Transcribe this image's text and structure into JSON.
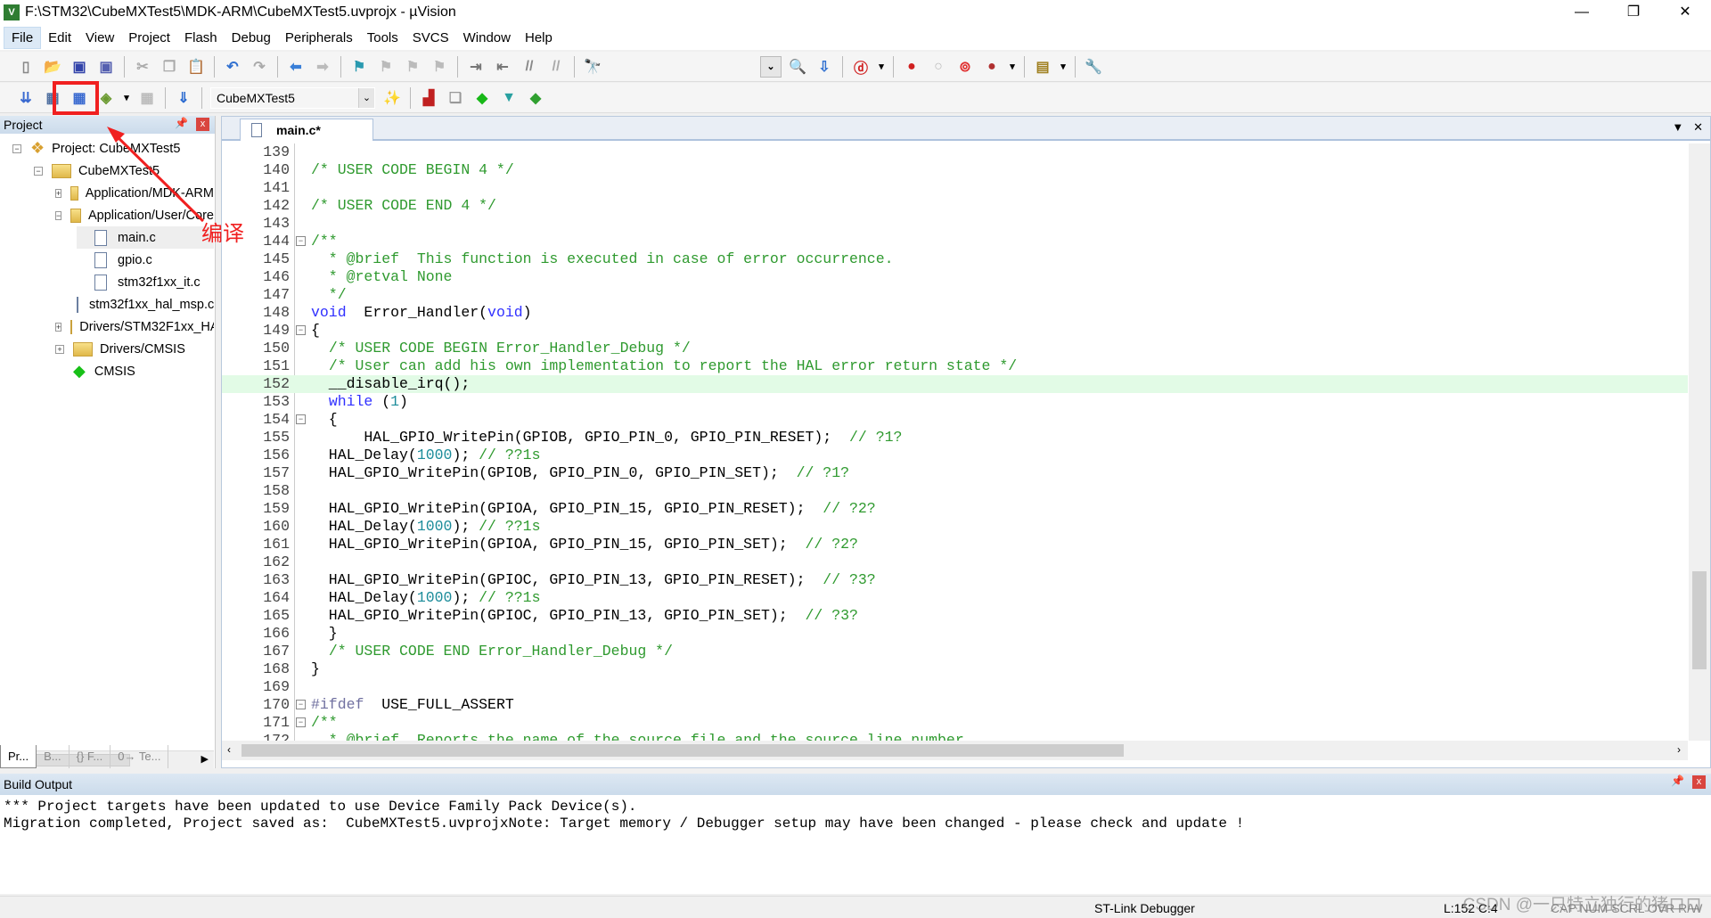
{
  "window": {
    "title": "F:\\STM32\\CubeMXTest5\\MDK-ARM\\CubeMXTest5.uvprojx - µVision",
    "icon_text": "V5"
  },
  "menu": [
    "File",
    "Edit",
    "View",
    "Project",
    "Flash",
    "Debug",
    "Peripherals",
    "Tools",
    "SVCS",
    "Window",
    "Help"
  ],
  "toolbar1": [
    {
      "icon": "new-file-icon",
      "g": "▯",
      "col": "#888"
    },
    {
      "icon": "open-icon",
      "g": "📂",
      "col": "#d8a030"
    },
    {
      "icon": "save-icon",
      "g": "▣",
      "col": "#3344aa"
    },
    {
      "icon": "save-all-icon",
      "g": "▣",
      "col": "#5560b0"
    },
    "|",
    {
      "icon": "cut-icon",
      "g": "✂",
      "col": "#aaa"
    },
    {
      "icon": "copy-icon",
      "g": "❐",
      "col": "#aaa"
    },
    {
      "icon": "paste-icon",
      "g": "📋",
      "col": "#c09030"
    },
    "|",
    {
      "icon": "undo-icon",
      "g": "↶",
      "col": "#3070d0"
    },
    {
      "icon": "redo-icon",
      "g": "↷",
      "col": "#aaa"
    },
    "|",
    {
      "icon": "back-icon",
      "g": "⬅",
      "col": "#3a80d8"
    },
    {
      "icon": "forward-icon",
      "g": "➡",
      "col": "#bbb"
    },
    "|",
    {
      "icon": "bookmark-icon",
      "g": "⚑",
      "col": "#2a9ab0"
    },
    {
      "icon": "prev-bookmark-icon",
      "g": "⚑",
      "col": "#bbb"
    },
    {
      "icon": "next-bookmark-icon",
      "g": "⚑",
      "col": "#bbb"
    },
    {
      "icon": "clear-bookmarks-icon",
      "g": "⚑",
      "col": "#bbb"
    },
    "|",
    {
      "icon": "indent-icon",
      "g": "⇥",
      "col": "#777"
    },
    {
      "icon": "unindent-icon",
      "g": "⇤",
      "col": "#777"
    },
    {
      "icon": "comment-icon",
      "g": "//",
      "col": "#888"
    },
    {
      "icon": "uncomment-icon",
      "g": "//",
      "col": "#aaa"
    },
    "|",
    {
      "icon": "find-in-files-icon",
      "g": "🔭",
      "col": "#c09030"
    }
  ],
  "toolbar1b": [
    {
      "icon": "find-icon",
      "g": "🔍",
      "col": "#555"
    },
    {
      "icon": "incremental-find-icon",
      "g": "⇩",
      "col": "#3070d0"
    },
    "|",
    {
      "icon": "debug-session-icon",
      "g": "ⓓ",
      "col": "#d02020"
    },
    {
      "icon": "dropdown-arrow-icon",
      "g": "▾",
      "col": "#000"
    },
    "|",
    {
      "icon": "breakpoint-icon",
      "g": "●",
      "col": "#d02020"
    },
    {
      "icon": "disable-breakpoint-icon",
      "g": "○",
      "col": "#bbb"
    },
    {
      "icon": "disable-all-breakpoints-icon",
      "g": "⊚",
      "col": "#e03030"
    },
    {
      "icon": "kill-breakpoints-icon",
      "g": "●",
      "col": "#b03030"
    },
    {
      "icon": "dropdown-arrow-icon",
      "g": "▾",
      "col": "#000"
    },
    "|",
    {
      "icon": "window-layout-icon",
      "g": "▤",
      "col": "#a08020"
    },
    {
      "icon": "dropdown-arrow-icon",
      "g": "▾",
      "col": "#000"
    },
    "|",
    {
      "icon": "configure-icon",
      "g": "🔧",
      "col": "#557"
    }
  ],
  "toolbar2": [
    {
      "icon": "translate-icon",
      "g": "⇊",
      "col": "#3a6ad0"
    },
    {
      "icon": "build-icon",
      "g": "▦",
      "col": "#5070a0"
    },
    {
      "icon": "rebuild-icon",
      "g": "▦",
      "col": "#3a6ad0"
    },
    {
      "icon": "batch-build-icon",
      "g": "◈",
      "col": "#6a9a30"
    },
    {
      "icon": "dropdown-arrow-icon",
      "g": "▾",
      "col": "#000"
    },
    {
      "icon": "stop-build-icon",
      "g": "▦",
      "col": "#bbb"
    },
    "|",
    {
      "icon": "download-load-icon",
      "g": "⇓",
      "col": "#2a6ad0"
    },
    "|"
  ],
  "toolbar2b": [
    {
      "icon": "options-for-target-icon",
      "g": "✨",
      "col": "#3060b0"
    },
    "|",
    {
      "icon": "manage-project-items-icon",
      "g": "▟",
      "col": "#c02020"
    },
    {
      "icon": "select-packs-icon",
      "g": "❏",
      "col": "#999"
    },
    {
      "icon": "manage-rte-icon",
      "g": "◆",
      "col": "#18b818"
    },
    {
      "icon": "pack-installer-icon",
      "g": "▼",
      "col": "#28a0a0"
    },
    {
      "icon": "pack-icon",
      "g": "◆",
      "col": "#30a030"
    }
  ],
  "target_select": "CubeMXTest5",
  "project_panel": {
    "title": "Project",
    "tree": [
      {
        "label": "Project: CubeMXTest5",
        "level": 0,
        "toggle": "−",
        "type": "project"
      },
      {
        "label": "CubeMXTest5",
        "level": 1,
        "toggle": "−",
        "type": "target"
      },
      {
        "label": "Application/MDK-ARM",
        "level": 2,
        "toggle": "+",
        "type": "folder"
      },
      {
        "label": "Application/User/Core",
        "level": 2,
        "toggle": "−",
        "type": "folder"
      },
      {
        "label": "main.c",
        "level": 3,
        "toggle": "",
        "type": "file",
        "selected": true
      },
      {
        "label": "gpio.c",
        "level": 3,
        "toggle": "",
        "type": "file"
      },
      {
        "label": "stm32f1xx_it.c",
        "level": 3,
        "toggle": "",
        "type": "file"
      },
      {
        "label": "stm32f1xx_hal_msp.c",
        "level": 3,
        "toggle": "",
        "type": "file"
      },
      {
        "label": "Drivers/STM32F1xx_HAL_Driver",
        "level": 2,
        "toggle": "+",
        "type": "folder"
      },
      {
        "label": "Drivers/CMSIS",
        "level": 2,
        "toggle": "+",
        "type": "folder"
      },
      {
        "label": "CMSIS",
        "level": 2,
        "toggle": "",
        "type": "rte"
      }
    ]
  },
  "panel_tabs": [
    "Pr...",
    "B...",
    "{} F...",
    "0→ Te..."
  ],
  "editor": {
    "tab": "main.c*",
    "highlight_line": 152,
    "lines": [
      {
        "n": 139,
        "s": []
      },
      {
        "n": 140,
        "s": [
          [
            "c",
            "/* USER CODE BEGIN 4 */"
          ]
        ]
      },
      {
        "n": 141,
        "s": []
      },
      {
        "n": 142,
        "s": [
          [
            "c",
            "/* USER CODE END 4 */"
          ]
        ]
      },
      {
        "n": 143,
        "s": []
      },
      {
        "n": 144,
        "s": [
          [
            "c",
            "/**"
          ]
        ],
        "fold": true
      },
      {
        "n": 145,
        "s": [
          [
            "c",
            "  * @brief  This function is executed in case of error occurrence."
          ]
        ]
      },
      {
        "n": 146,
        "s": [
          [
            "c",
            "  * @retval None"
          ]
        ]
      },
      {
        "n": 147,
        "s": [
          [
            "c",
            "  */"
          ]
        ]
      },
      {
        "n": 148,
        "s": [
          [
            "k",
            "void"
          ],
          [
            "",
            "  Error_Handler("
          ],
          [
            "k",
            "void"
          ],
          [
            "",
            ")"
          ]
        ]
      },
      {
        "n": 149,
        "s": [
          [
            "",
            "{"
          ]
        ],
        "fold": true
      },
      {
        "n": 150,
        "s": [
          [
            "",
            "  "
          ],
          [
            "c",
            "/* USER CODE BEGIN Error_Handler_Debug */"
          ]
        ]
      },
      {
        "n": 151,
        "s": [
          [
            "",
            "  "
          ],
          [
            "c",
            "/* User can add his own implementation to report the HAL error return state */"
          ]
        ]
      },
      {
        "n": 152,
        "s": [
          [
            "",
            "  __disable_irq();"
          ]
        ]
      },
      {
        "n": 153,
        "s": [
          [
            "",
            "  "
          ],
          [
            "k",
            "while"
          ],
          [
            "",
            " ("
          ],
          [
            "n",
            "1"
          ],
          [
            "",
            ")"
          ]
        ]
      },
      {
        "n": 154,
        "s": [
          [
            "",
            "  {"
          ]
        ],
        "fold": true
      },
      {
        "n": 155,
        "s": [
          [
            "",
            "      HAL_GPIO_WritePin(GPIOB, GPIO_PIN_0, GPIO_PIN_RESET);  "
          ],
          [
            "c",
            "// ?1?"
          ]
        ]
      },
      {
        "n": 156,
        "s": [
          [
            "",
            "  HAL_Delay("
          ],
          [
            "n",
            "1000"
          ],
          [
            "",
            "); "
          ],
          [
            "c",
            "// ??1s"
          ]
        ]
      },
      {
        "n": 157,
        "s": [
          [
            "",
            "  HAL_GPIO_WritePin(GPIOB, GPIO_PIN_0, GPIO_PIN_SET);  "
          ],
          [
            "c",
            "// ?1?"
          ]
        ]
      },
      {
        "n": 158,
        "s": []
      },
      {
        "n": 159,
        "s": [
          [
            "",
            "  HAL_GPIO_WritePin(GPIOA, GPIO_PIN_15, GPIO_PIN_RESET);  "
          ],
          [
            "c",
            "// ?2?"
          ]
        ]
      },
      {
        "n": 160,
        "s": [
          [
            "",
            "  HAL_Delay("
          ],
          [
            "n",
            "1000"
          ],
          [
            "",
            "); "
          ],
          [
            "c",
            "// ??1s"
          ]
        ]
      },
      {
        "n": 161,
        "s": [
          [
            "",
            "  HAL_GPIO_WritePin(GPIOA, GPIO_PIN_15, GPIO_PIN_SET);  "
          ],
          [
            "c",
            "// ?2?"
          ]
        ]
      },
      {
        "n": 162,
        "s": []
      },
      {
        "n": 163,
        "s": [
          [
            "",
            "  HAL_GPIO_WritePin(GPIOC, GPIO_PIN_13, GPIO_PIN_RESET);  "
          ],
          [
            "c",
            "// ?3?"
          ]
        ]
      },
      {
        "n": 164,
        "s": [
          [
            "",
            "  HAL_Delay("
          ],
          [
            "n",
            "1000"
          ],
          [
            "",
            "); "
          ],
          [
            "c",
            "// ??1s"
          ]
        ]
      },
      {
        "n": 165,
        "s": [
          [
            "",
            "  HAL_GPIO_WritePin(GPIOC, GPIO_PIN_13, GPIO_PIN_SET);  "
          ],
          [
            "c",
            "// ?3?"
          ]
        ]
      },
      {
        "n": 166,
        "s": [
          [
            "",
            "  }"
          ]
        ]
      },
      {
        "n": 167,
        "s": [
          [
            "",
            "  "
          ],
          [
            "c",
            "/* USER CODE END Error_Handler_Debug */"
          ]
        ]
      },
      {
        "n": 168,
        "s": [
          [
            "",
            "}"
          ]
        ]
      },
      {
        "n": 169,
        "s": []
      },
      {
        "n": 170,
        "s": [
          [
            "p",
            "#ifdef"
          ],
          [
            "",
            "  USE_FULL_ASSERT"
          ]
        ],
        "fold": true
      },
      {
        "n": 171,
        "s": [
          [
            "c",
            "/**"
          ]
        ],
        "fold": true
      },
      {
        "n": 172,
        "s": [
          [
            "c",
            "  * @brief  Reports the name of the source file and the source line number"
          ]
        ]
      }
    ]
  },
  "build_output": {
    "title": "Build Output",
    "lines": [
      "*** Project targets have been updated to use Device Family Pack Device(s).",
      "Migration completed, Project saved as:  CubeMXTest5.uvprojxNote: Target memory / Debugger setup may have been changed - please check and update !"
    ]
  },
  "status": {
    "debugger": "ST-Link Debugger",
    "position": "L:152 C:4",
    "flags": "CAP  NUM  SCRL  OVR  R/W"
  },
  "annotation": {
    "text": "编译",
    "color": "#f02020"
  },
  "watermark": "CSDN @一只特立独行的猪ロロ",
  "colors": {
    "comment": "#2f9a2f",
    "keyword": "#3030ff",
    "number": "#1c8c9a",
    "highlight": "#e2fbe6"
  }
}
